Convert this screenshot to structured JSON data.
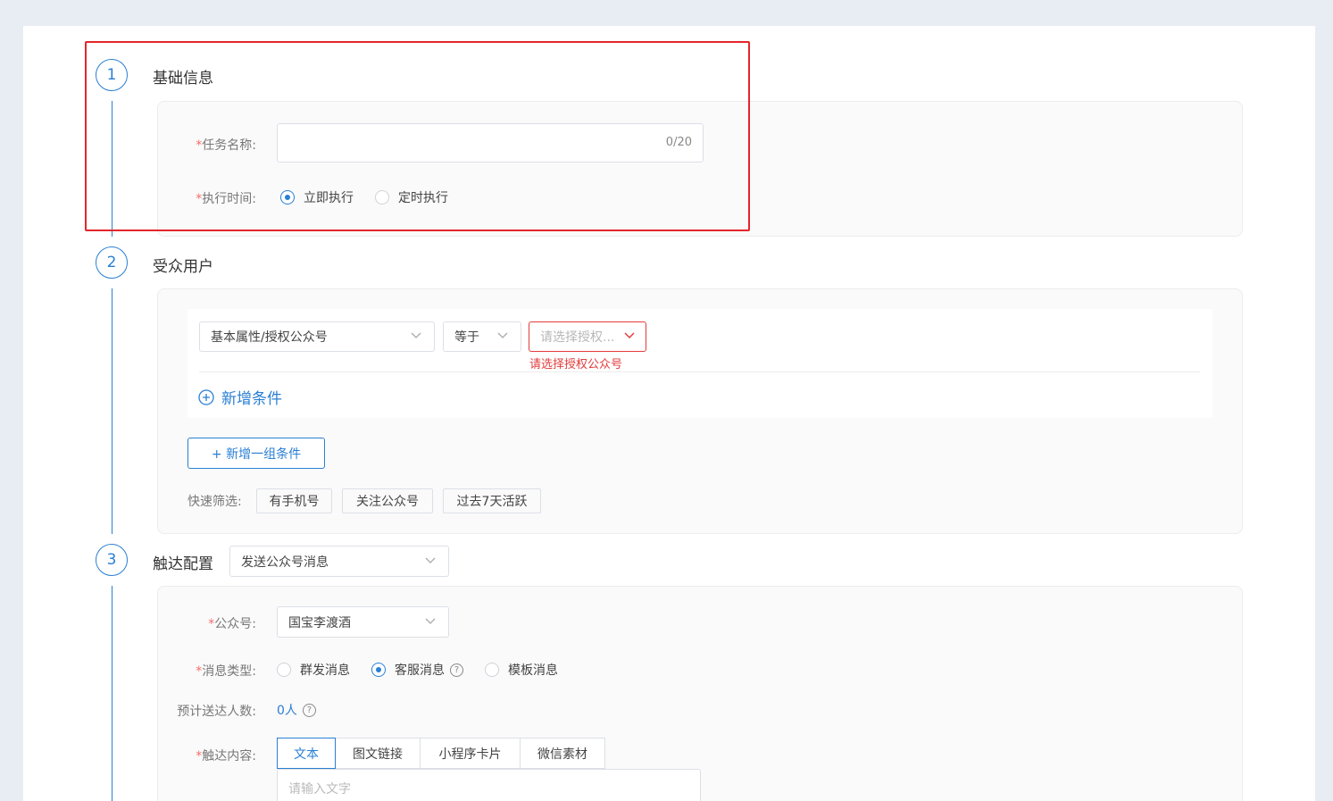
{
  "steps": [
    {
      "number": "1",
      "title": "基础信息"
    },
    {
      "number": "2",
      "title": "受众用户"
    },
    {
      "number": "3",
      "title": "触达配置"
    }
  ],
  "basic": {
    "task_name_label": "任务名称:",
    "task_name_value": "",
    "task_name_counter": "0/20",
    "exec_time_label": "执行时间:",
    "exec_options": [
      "立即执行",
      "定时执行"
    ],
    "exec_selected": 0
  },
  "audience": {
    "attr_select": "基本属性/授权公众号",
    "operator_select": "等于",
    "value_placeholder": "请选择授权...",
    "value_error": "请选择授权公众号",
    "add_condition": "新增条件",
    "add_group": "+ 新增一组条件",
    "quick_filter_label": "快速筛选:",
    "quick_filters": [
      "有手机号",
      "关注公众号",
      "过去7天活跃"
    ]
  },
  "reach": {
    "channel_select": "发送公众号消息",
    "account_label": "公众号:",
    "account_value": "国宝李渡酒",
    "msg_type_label": "消息类型:",
    "msg_types": [
      "群发消息",
      "客服消息",
      "模板消息"
    ],
    "msg_type_selected": 1,
    "estimate_label": "预计送达人数:",
    "estimate_value": "0人",
    "content_label": "触达内容:",
    "content_tabs": [
      "文本",
      "图文链接",
      "小程序卡片",
      "微信素材"
    ],
    "content_tab_selected": 0,
    "text_placeholder": "请输入文字"
  },
  "colors": {
    "accent": "#2a7fd4",
    "error": "#e33b3b",
    "highlight": "#e4262b"
  }
}
